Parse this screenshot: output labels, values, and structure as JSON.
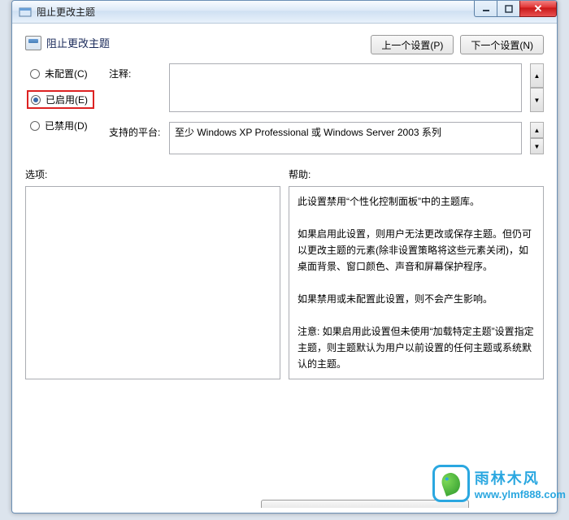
{
  "window": {
    "title": "阻止更改主题"
  },
  "header": {
    "title": "阻止更改主题"
  },
  "nav": {
    "prev": "上一个设置(P)",
    "next": "下一个设置(N)"
  },
  "radios": {
    "not_configured": "未配置(C)",
    "enabled": "已启用(E)",
    "disabled": "已禁用(D)"
  },
  "labels": {
    "comment": "注释:",
    "platforms": "支持的平台:",
    "options": "选项:",
    "help": "帮助:"
  },
  "platform_text": "至少 Windows XP Professional 或 Windows Server 2003 系列",
  "help_text": "此设置禁用“个性化控制面板”中的主题库。\n\n如果启用此设置，则用户无法更改或保存主题。但仍可以更改主题的元素(除非设置策略将这些元素关闭)，如桌面背景、窗口颜色、声音和屏幕保护程序。\n\n如果禁用或未配置此设置，则不会产生影响。\n\n注意: 如果启用此设置但未使用“加载特定主题”设置指定主题，则主题默认为用户以前设置的任何主题或系统默认的主题。",
  "watermark": {
    "cn": "雨林木风",
    "url": "www.ylmf888.com"
  }
}
